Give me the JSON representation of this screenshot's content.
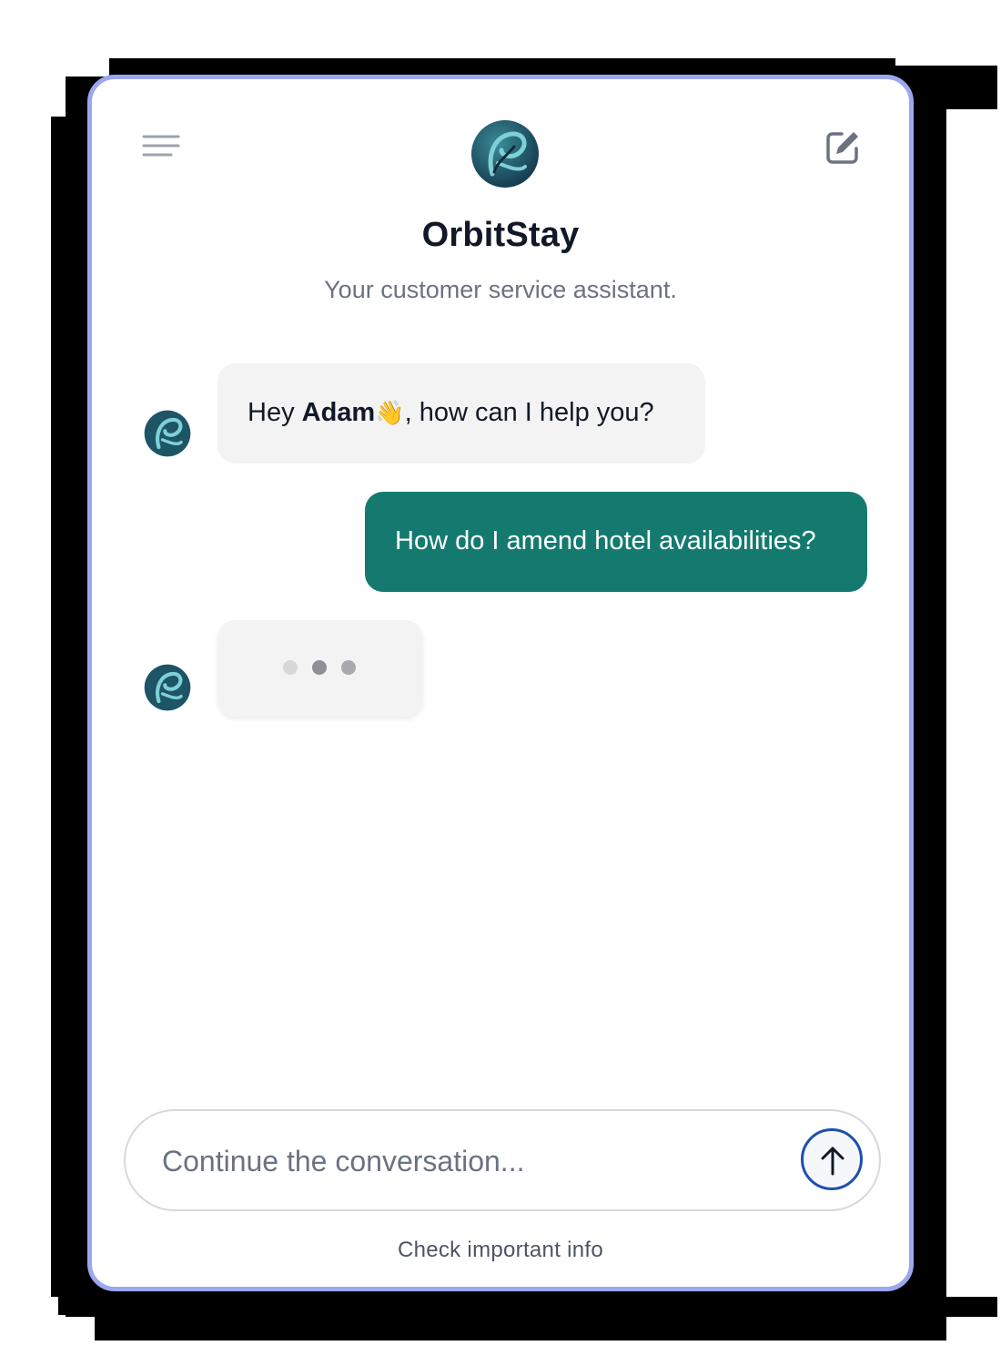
{
  "header": {
    "title": "OrbitStay",
    "subtitle": "Your customer service assistant.",
    "menu_icon": "hamburger-menu-icon",
    "edit_icon": "new-chat-edit-icon",
    "logo": "orbitstay-logo"
  },
  "messages": [
    {
      "role": "assistant",
      "prefix": "Hey ",
      "name": "Adam",
      "emoji": "👋",
      "suffix": ", how can I help you?"
    },
    {
      "role": "user",
      "text": "How do I amend hotel availabilities?"
    },
    {
      "role": "assistant",
      "typing": true
    }
  ],
  "composer": {
    "placeholder": "Continue the conversation...",
    "send_icon": "arrow-up-icon"
  },
  "footer": {
    "note": "Check important info"
  },
  "colors": {
    "frame_border": "#9aa8ef",
    "user_bubble": "#147a6f",
    "bot_bubble": "#f3f3f4",
    "send_border": "#1e4fb0",
    "logo_dark": "#173d52",
    "logo_teal": "#2f8f9a"
  }
}
